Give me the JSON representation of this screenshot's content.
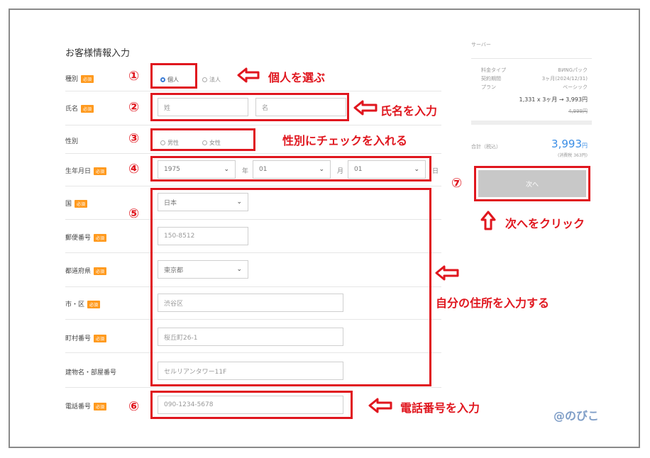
{
  "form": {
    "title": "お客様情報入力",
    "required_badge": "必須",
    "type_label": "種別",
    "type_options": [
      "個人",
      "法人"
    ],
    "name_label": "氏名",
    "last_name_placeholder": "姓",
    "first_name_placeholder": "名",
    "gender_label": "性別",
    "gender_options": [
      "男性",
      "女性"
    ],
    "birth_label": "生年月日",
    "birth_year": "1975",
    "year_unit": "年",
    "birth_month": "01",
    "month_unit": "月",
    "birth_day": "01",
    "day_unit": "日",
    "country_label": "国",
    "country_value": "日本",
    "postal_label": "郵便番号",
    "postal_value": "150-8512",
    "prefecture_label": "都道府県",
    "prefecture_value": "東京都",
    "city_label": "市・区",
    "city_value": "渋谷区",
    "town_label": "町村番号",
    "town_value": "桜丘町26-1",
    "building_label": "建物名・部屋番号",
    "building_value": "セルリアンタワー11F",
    "phone_label": "電話番号",
    "phone_value": "090-1234-5678"
  },
  "summary": {
    "header": "サーバー",
    "rows": [
      {
        "k": "料金タイプ",
        "v": "ВИNGパック"
      },
      {
        "k": "契約期間",
        "v": "3ヶ月(2024/12/31)"
      },
      {
        "k": "プラン",
        "v": "ベーシック"
      }
    ],
    "price_line": "1,331 x 3ヶ月 → 3,993円",
    "strike_price": "4,999円",
    "total_label": "合計（税込）",
    "total_value": "3,993",
    "total_unit": "円",
    "tax_note": "(消費税 363円)",
    "next_button": "次へ"
  },
  "annotations": {
    "steps": [
      "①",
      "②",
      "③",
      "④",
      "⑤",
      "⑥",
      "⑦"
    ],
    "step1": "個人を選ぶ",
    "step2": "氏名を入力",
    "step3": "性別にチェックを入れる",
    "step5": "自分の住所を入力する",
    "step6": "電話番号を入力",
    "step7": "次へをクリック",
    "credit": "@のびこ"
  },
  "colors": {
    "accent": "#e0161e",
    "badge": "#ff9a1e",
    "total": "#3a8ee6",
    "button": "#c8c8c8"
  }
}
